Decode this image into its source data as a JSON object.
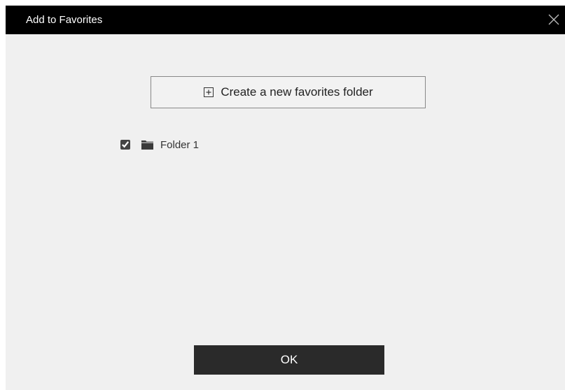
{
  "dialog": {
    "title": "Add to Favorites",
    "close_icon": "close-icon"
  },
  "create_folder": {
    "icon": "plus-square-icon",
    "label": "Create a new favorites folder"
  },
  "folders": [
    {
      "label": "Folder 1",
      "checked": true,
      "icon": "folder-icon"
    }
  ],
  "ok_button": {
    "label": "OK"
  },
  "colors": {
    "titlebar": "#000000",
    "dialog_background": "#f0f0f0",
    "ok_button_background": "#2a2a2a"
  }
}
